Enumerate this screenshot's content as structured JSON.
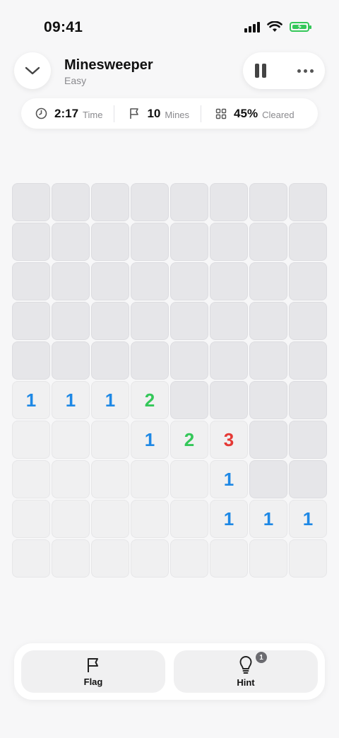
{
  "status_bar": {
    "time": "09:41",
    "icons": [
      "signal-icon",
      "wifi-icon",
      "battery-charging-icon"
    ]
  },
  "header": {
    "title": "Minesweeper",
    "subtitle": "Easy",
    "back_icon": "chevron-down-icon",
    "pause_icon": "pause-icon",
    "more_icon": "more-icon"
  },
  "stats": {
    "time_value": "2:17",
    "time_label": "Time",
    "mines_value": "10",
    "mines_label": "Mines",
    "cleared_value": "45%",
    "cleared_label": "Cleared"
  },
  "board": {
    "rows": 10,
    "cols": 8,
    "cells": [
      [
        "h",
        "h",
        "h",
        "h",
        "h",
        "h",
        "h",
        "h"
      ],
      [
        "h",
        "h",
        "h",
        "h",
        "h",
        "h",
        "h",
        "h"
      ],
      [
        "h",
        "h",
        "h",
        "h",
        "h",
        "h",
        "h",
        "h"
      ],
      [
        "h",
        "h",
        "h",
        "h",
        "h",
        "h",
        "h",
        "h"
      ],
      [
        "h",
        "h",
        "h",
        "h",
        "h",
        "h",
        "h",
        "h"
      ],
      [
        "1",
        "1",
        "1",
        "2",
        "h",
        "h",
        "h",
        "h"
      ],
      [
        "0",
        "0",
        "0",
        "1",
        "2",
        "3",
        "h",
        "h"
      ],
      [
        "0",
        "0",
        "0",
        "0",
        "0",
        "1",
        "h",
        "h"
      ],
      [
        "0",
        "0",
        "0",
        "0",
        "0",
        "1",
        "1",
        "1"
      ],
      [
        "0",
        "0",
        "0",
        "0",
        "0",
        "0",
        "0",
        "0"
      ]
    ],
    "number_colors": {
      "1": "#1e88e5",
      "2": "#34c759",
      "3": "#e53935"
    }
  },
  "controls": {
    "flag_label": "Flag",
    "flag_icon": "flag-icon",
    "hint_label": "Hint",
    "hint_icon": "lightbulb-icon",
    "hint_badge": "1"
  }
}
